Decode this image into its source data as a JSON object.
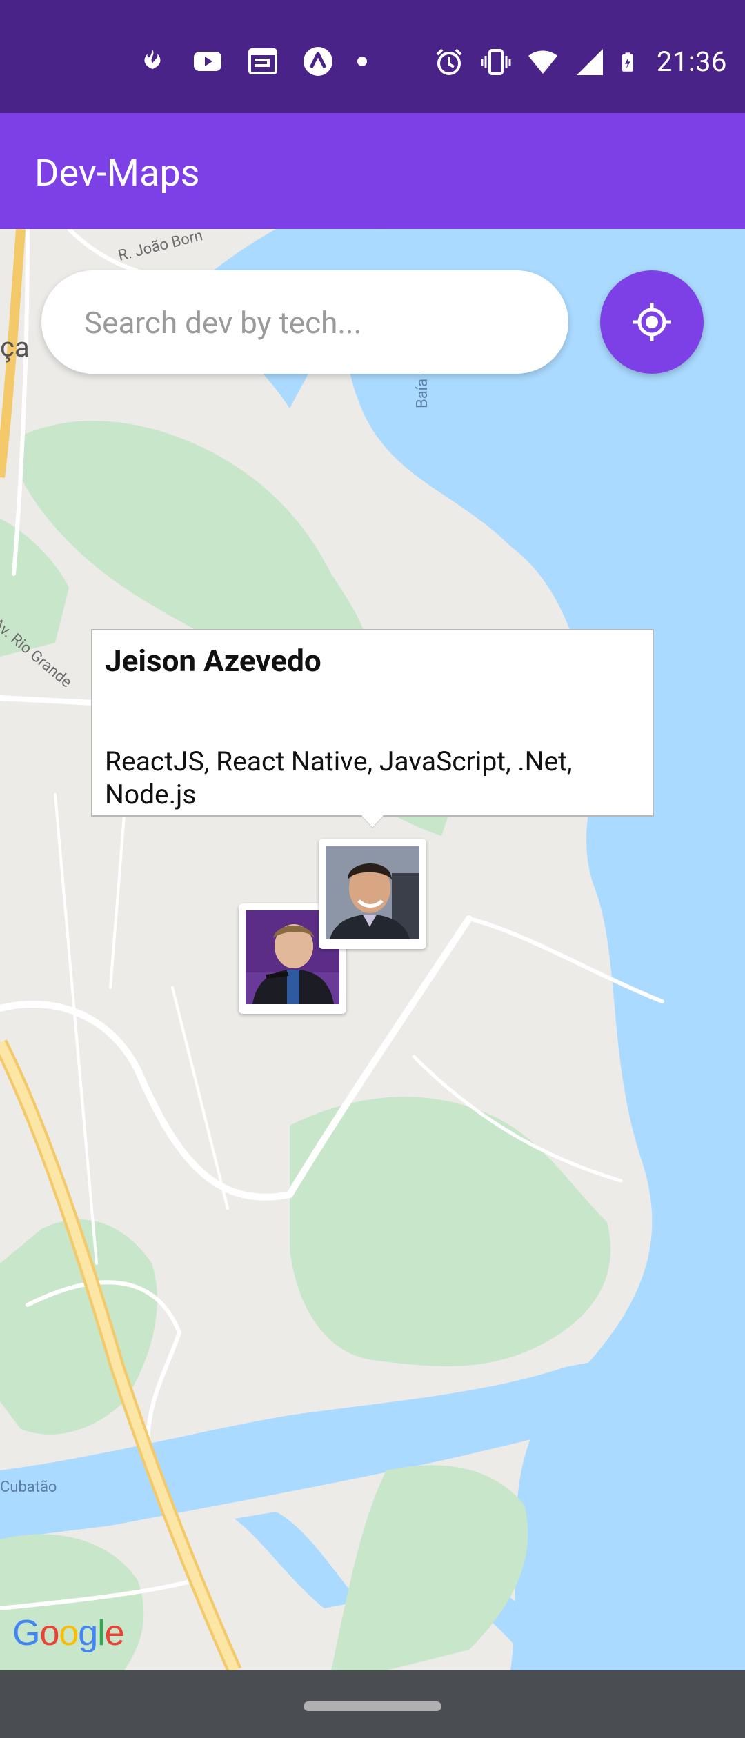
{
  "status_bar": {
    "time": "21:36",
    "left_icons": [
      "santander-icon",
      "youtube-icon",
      "news-icon",
      "arc-icon",
      "dot-icon"
    ],
    "right_icons": [
      "alarm-icon",
      "vibrate-icon",
      "wifi-icon",
      "signal-icon",
      "battery-charging-icon"
    ]
  },
  "app_bar": {
    "title": "Dev-Maps"
  },
  "search": {
    "placeholder": "Search dev by tech...",
    "value": ""
  },
  "locate_button": {
    "icon": "my-location-icon"
  },
  "callout": {
    "name": "Jeison Azevedo",
    "techs": "ReactJS, React Native, JavaScript, .Net, Node.js"
  },
  "map_labels": {
    "street_1": "R. João Born",
    "place_partial": "ça",
    "bay": "Baía da Palhoça",
    "street_2": "Av. Rio Grande",
    "area": "Cubatão"
  },
  "colors": {
    "status_bar": "#4a2389",
    "app_bar": "#7d40e7",
    "accent": "#7d40e7",
    "water": "#aadaff",
    "park": "#c8e6c9",
    "highway": "#f8dd84"
  }
}
